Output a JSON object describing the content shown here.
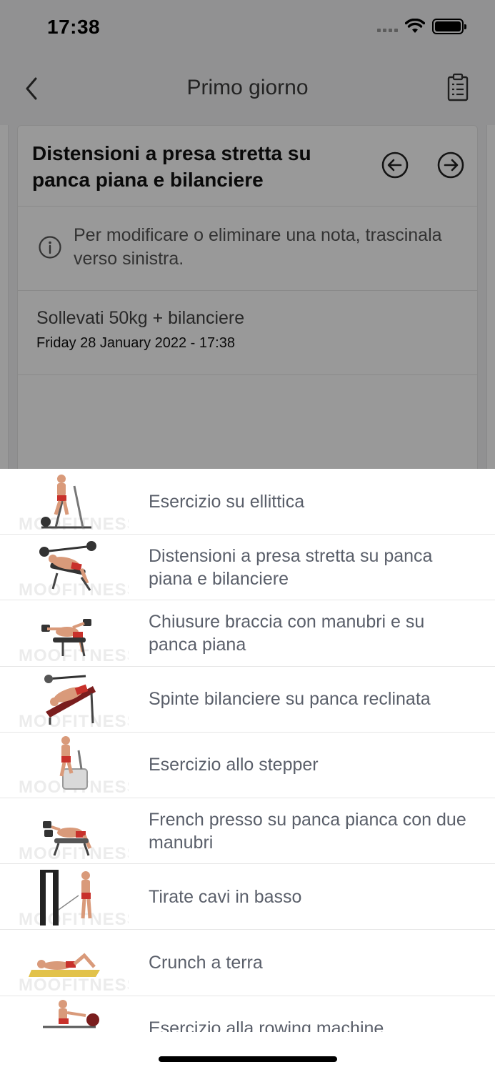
{
  "status_bar": {
    "time": "17:38"
  },
  "nav": {
    "title": "Primo giorno"
  },
  "card": {
    "title": "Distensioni a presa stretta su panca piana e bilanciere",
    "info_text": "Per modificare o eliminare una nota, trascinala verso sinistra.",
    "note": {
      "title": "Sollevati 50kg + bilanciere",
      "date": "Friday 28 January 2022 - 17:38"
    }
  },
  "watermark": "MOOFITNESS",
  "exercises": [
    {
      "label": "Esercizio su ellittica",
      "icon": "elliptical-icon"
    },
    {
      "label": "Distensioni a presa stretta su panca piana e bilanciere",
      "icon": "bench-press-icon"
    },
    {
      "label": "Chiusure braccia con manubri e su panca piana",
      "icon": "dumbbell-fly-icon"
    },
    {
      "label": "Spinte bilanciere su panca reclinata",
      "icon": "incline-press-icon"
    },
    {
      "label": "Esercizio allo stepper",
      "icon": "stepper-icon"
    },
    {
      "label": "French presso su panca pianca con due manubri",
      "icon": "french-press-icon"
    },
    {
      "label": "Tirate cavi in basso",
      "icon": "cable-row-icon"
    },
    {
      "label": "Crunch a terra",
      "icon": "crunch-icon"
    },
    {
      "label": "Esercizio alla rowing machine",
      "icon": "rowing-machine-icon"
    }
  ],
  "colors": {
    "accent_red": "#c8312b",
    "text_gray": "#5a5f6a",
    "overlay": "rgba(0,0,0,0.40)"
  }
}
